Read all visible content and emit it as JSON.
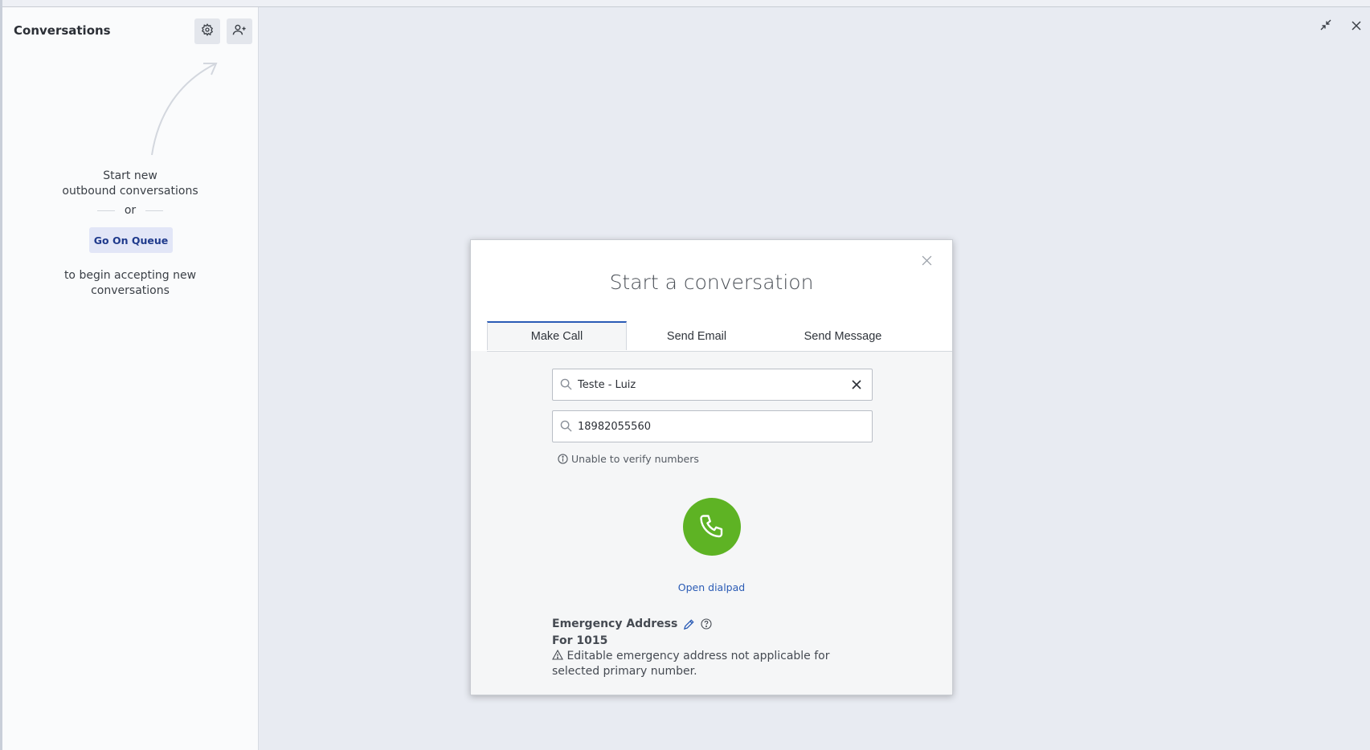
{
  "sidebar": {
    "title": "Conversations",
    "settings_icon": "gear-icon",
    "add_user_icon": "add-user-icon",
    "prompt_line1": "Start new",
    "prompt_line2": "outbound conversations",
    "or_text": "or",
    "queue_button": "Go On Queue",
    "queue_line1": "to begin accepting new",
    "queue_line2": "conversations"
  },
  "window": {
    "minimize_icon": "minimize-icon",
    "close_icon": "close-icon"
  },
  "modal": {
    "title": "Start a conversation",
    "tabs": [
      {
        "label": "Make Call",
        "active": true
      },
      {
        "label": "Send Email",
        "active": false
      },
      {
        "label": "Send Message",
        "active": false
      }
    ],
    "contact_value": "Teste - Luiz",
    "number_value": "18982055560",
    "verify_hint": "Unable to verify numbers",
    "dialpad_link": "Open dialpad",
    "emergency_title": "Emergency Address",
    "emergency_for": "For 1015",
    "emergency_note": "Editable emergency address not applicable for selected primary number.",
    "accent_color": "#2a5bb5",
    "call_color": "#5eb324"
  }
}
